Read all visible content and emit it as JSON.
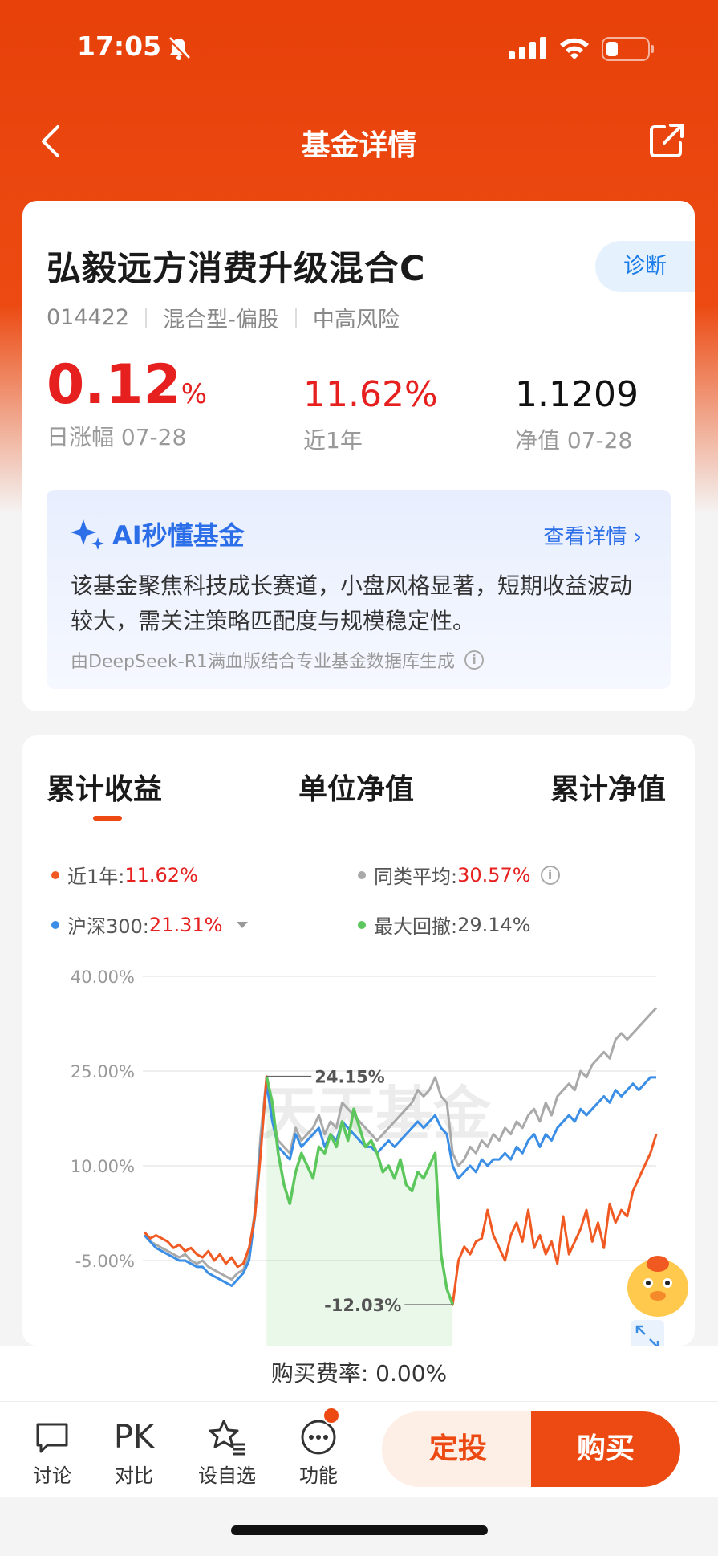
{
  "status": {
    "time": "17:05"
  },
  "nav": {
    "title": "基金详情"
  },
  "fund": {
    "name": "弘毅远方消费升级混合C",
    "code": "014422",
    "type": "混合型-偏股",
    "risk": "中高风险",
    "diagnose_label": "诊断",
    "daily_change": "0.12",
    "daily_change_unit": "%",
    "daily_change_label": "日涨幅 07-28",
    "year_return": "11.62%",
    "year_return_label": "近1年",
    "nav_value": "1.1209",
    "nav_label": "净值 07-28"
  },
  "ai": {
    "title": "AI秒懂基金",
    "more": "查看详情 ›",
    "text": "该基金聚焦科技成长赛道，小盘风格显著，短期收益波动较大，需关注策略匹配度与规模稳定性。",
    "footer": "由DeepSeek-R1满血版结合专业基金数据库生成"
  },
  "tabs": [
    "累计收益",
    "单位净值",
    "累计净值"
  ],
  "legend": {
    "fund_label": "近1年:",
    "fund_value": "11.62%",
    "peer_label": "同类平均:",
    "peer_value": "30.57%",
    "index_label": "沪深300:",
    "index_value": "21.31%",
    "drawdown_label": "最大回撤:",
    "drawdown_value": "29.14%"
  },
  "colors": {
    "fund": "#f05a22",
    "peer": "#a9a9a9",
    "index": "#3a8ee6",
    "drawdown": "#5cc75c",
    "accent": "#ec4a12"
  },
  "chart_data": {
    "type": "line",
    "y_ticks": [
      "40.00%",
      "25.00%",
      "10.00%",
      "-5.00%"
    ],
    "ylim": [
      -12,
      40
    ],
    "annotations": {
      "high": "24.15%",
      "low": "-12.03%"
    },
    "watermark": "天天基金",
    "series": [
      {
        "name": "近1年",
        "values": [
          -0.5,
          -1.5,
          -1,
          -1.5,
          -2,
          -3,
          -2.5,
          -3.5,
          -3,
          -4,
          -4.5,
          -3.5,
          -5,
          -4,
          -5.5,
          -4.5,
          -6,
          -5.5,
          -3,
          2,
          12,
          24.15,
          20,
          12,
          7,
          4,
          9,
          12,
          10,
          8,
          13,
          12,
          15,
          13,
          17,
          14,
          19,
          16,
          13,
          14,
          12,
          9,
          10,
          8,
          11,
          7,
          6,
          9,
          8,
          10,
          12,
          -4,
          -9.5,
          -12,
          -5,
          -2.8,
          -4,
          -2,
          -1.5,
          3,
          -1,
          -3,
          -5,
          -1,
          1,
          -2,
          3,
          -3,
          -1,
          -4,
          -2,
          -5.5,
          2,
          -4,
          -2,
          0,
          3,
          -2,
          1,
          -3,
          4,
          1,
          3,
          2,
          6,
          8,
          10,
          12,
          15
        ]
      },
      {
        "name": "同类平均",
        "values": [
          -1,
          -2,
          -2.5,
          -3,
          -3.5,
          -4,
          -4.5,
          -4,
          -5,
          -5.5,
          -5,
          -6,
          -6.5,
          -7,
          -7.5,
          -8,
          -7,
          -6.5,
          -4,
          3,
          15,
          24,
          18,
          14,
          13,
          12,
          16,
          14,
          15,
          16,
          18,
          15,
          17,
          16,
          20,
          19,
          18,
          17,
          16,
          15,
          14,
          15,
          16,
          17,
          18,
          19,
          20,
          22,
          21,
          22,
          24,
          21,
          20,
          12,
          10,
          11,
          13,
          12,
          14,
          13,
          15,
          14,
          16,
          15,
          17,
          16,
          18,
          19,
          17,
          20,
          18,
          21,
          22,
          23,
          22,
          25,
          24,
          26,
          27,
          28,
          27,
          30,
          31,
          30,
          31,
          32,
          33,
          34,
          35
        ]
      },
      {
        "name": "沪深300",
        "values": [
          -1,
          -2,
          -3,
          -3.5,
          -4,
          -4.5,
          -5,
          -5,
          -5.5,
          -6,
          -6,
          -7,
          -7.5,
          -8,
          -8.5,
          -9,
          -8,
          -7,
          -5,
          2,
          13,
          23,
          17,
          13,
          12,
          11,
          15,
          13,
          14,
          15,
          16,
          13,
          15,
          14,
          17,
          16,
          15,
          14,
          13,
          13,
          12,
          13,
          14,
          13,
          14,
          15,
          16,
          17,
          16,
          17,
          18,
          16,
          15,
          10,
          8,
          9,
          10,
          9,
          11,
          10,
          11,
          11,
          12,
          11,
          13,
          12,
          14,
          15,
          13,
          15,
          14,
          16,
          17,
          18,
          17,
          19,
          18,
          19,
          20,
          21,
          20,
          22,
          21,
          22,
          23,
          22,
          23,
          24,
          24
        ]
      }
    ]
  },
  "fee": {
    "text": "购买费率: 0.00%"
  },
  "toolbar": {
    "discuss": "讨论",
    "pk_icon_text": "PK",
    "pk": "对比",
    "fav": "设自选",
    "func": "功能",
    "plan": "定投",
    "buy": "购买"
  }
}
